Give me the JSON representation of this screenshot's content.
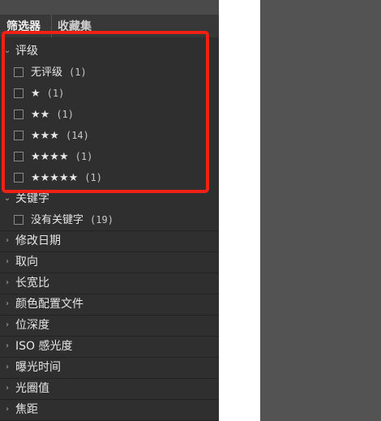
{
  "tabs": [
    {
      "label": "筛选器"
    },
    {
      "label": "收藏集"
    }
  ],
  "sections": {
    "rating": {
      "label": "评级",
      "items": [
        {
          "label": "无评级",
          "count": "(1)"
        },
        {
          "label": "★",
          "count": "(1)"
        },
        {
          "label": "★★",
          "count": "(1)"
        },
        {
          "label": "★★★",
          "count": "(14)"
        },
        {
          "label": "★★★★",
          "count": "(1)"
        },
        {
          "label": "★★★★★",
          "count": "(1)"
        }
      ]
    },
    "keywords": {
      "label": "关键字",
      "items": [
        {
          "label": "没有关键字",
          "count": "(19)"
        }
      ]
    },
    "collapsed": [
      {
        "label": "修改日期"
      },
      {
        "label": "取向"
      },
      {
        "label": "长宽比"
      },
      {
        "label": "颜色配置文件"
      },
      {
        "label": "位深度"
      },
      {
        "label": "ISO 感光度"
      },
      {
        "label": "曝光时间"
      },
      {
        "label": "光圈值"
      },
      {
        "label": "焦距"
      }
    ]
  },
  "colors": {
    "panel_bg": "#2f2f2f",
    "highlight_border": "#f02015",
    "right_panel_bg": "#535353"
  },
  "icons": {
    "expanded": "chevron-down-icon",
    "collapsed": "chevron-right-icon",
    "checkbox": "checkbox-icon"
  }
}
